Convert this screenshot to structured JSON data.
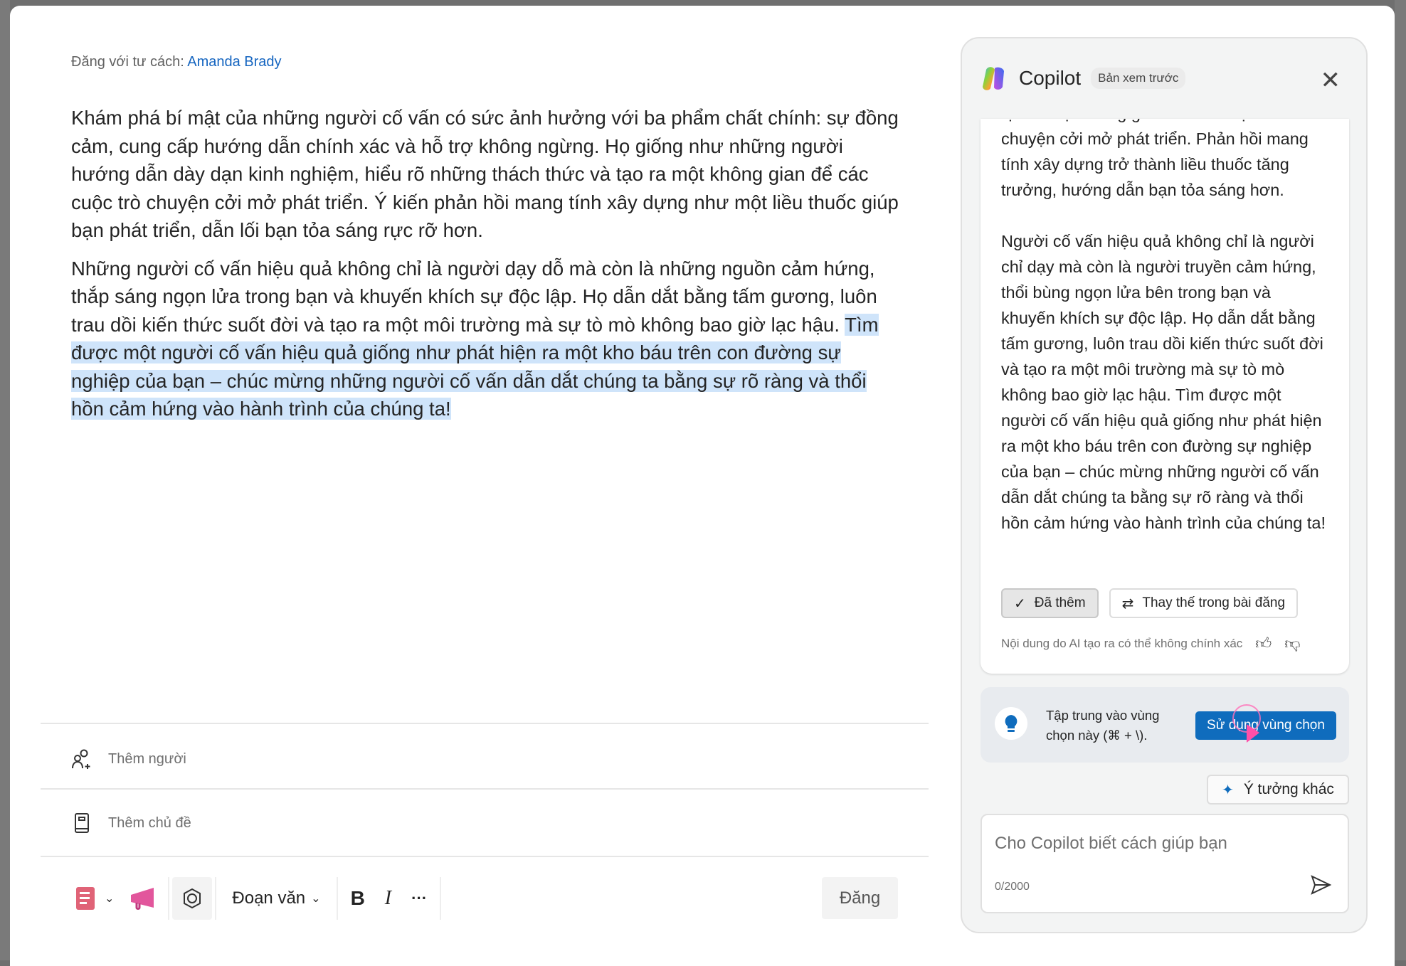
{
  "post": {
    "posting_as_label": "Đăng với tư cách:",
    "posting_as_name": "Amanda Brady",
    "paragraph1": "Khám phá bí mật của những người cố vấn có sức ảnh hưởng với ba phẩm chất chính: sự đồng cảm, cung cấp hướng dẫn chính xác và hỗ trợ không ngừng. Họ giống như những người hướng dẫn dày dạn kinh nghiệm, hiểu rõ những thách thức và tạo ra một không gian để các cuộc trò chuyện cởi mở phát triển. Ý kiến phản hồi mang tính xây dựng như một liều thuốc giúp bạn phát triển, dẫn lối bạn tỏa sáng rực rỡ hơn.",
    "paragraph2_plain": "Những người cố vấn hiệu quả không chỉ là người dạy dỗ mà còn là những nguồn cảm hứng, thắp sáng ngọn lửa trong bạn và khuyến khích sự độc lập. Họ dẫn dắt bằng tấm gương, luôn trau dồi kiến thức suốt đời và tạo ra một môi trường mà sự tò mò không bao giờ lạc hậu.",
    "paragraph2_selected": "Tìm được một người cố vấn hiệu quả giống như phát hiện ra một kho báu trên con đường sự nghiệp của bạn – chúc mừng những người cố vấn dẫn dắt chúng ta bằng sự rõ ràng và thổi hồn cảm hứng vào hành trình của chúng ta!",
    "add_people": "Thêm người",
    "add_topic": "Thêm chủ đề",
    "toolbar": {
      "paragraph_style": "Đoạn văn",
      "bold": "B",
      "italic": "I",
      "more": "···",
      "post_button": "Đăng"
    }
  },
  "copilot": {
    "title": "Copilot",
    "badge": "Bản xem trước",
    "response_p1": "tạo ra một không gian để các cuộc trò chuyện cởi mở phát triển. Phản hồi mang tính xây dựng trở thành liều thuốc tăng trưởng, hướng dẫn bạn tỏa sáng hơn.",
    "response_p2": "Người cố vấn hiệu quả không chỉ là người chỉ dạy mà còn là người truyền cảm hứng, thổi bùng ngọn lửa bên trong bạn và khuyến khích sự độc lập. Họ dẫn dắt bằng tấm gương, luôn trau dồi kiến thức suốt đời và tạo ra một môi trường mà sự tò mò không bao giờ lạc hậu. Tìm được một người cố vấn hiệu quả giống như phát hiện ra một kho báu trên con đường sự nghiệp của bạn – chúc mừng những người cố vấn dẫn dắt chúng ta bằng sự rõ ràng và thổi hồn cảm hứng vào hành trình của chúng ta!",
    "added_button": "Đã thêm",
    "replace_button": "Thay thế trong bài đăng",
    "disclaimer": "Nội dung do AI tạo ra có thể không chính xác",
    "focus_text": "Tập trung vào vùng chọn này (⌘ + \\).",
    "use_selection_button": "Sử dụng vùng chọn",
    "more_ideas_button": "Ý tưởng khác",
    "input_placeholder": "Cho Copilot biết cách giúp bạn",
    "char_count": "0/2000"
  },
  "colors": {
    "accent": "#0f6cbd",
    "link": "#1565c0",
    "selection": "#cfe4fa",
    "cursor": "#ff4fa8"
  }
}
